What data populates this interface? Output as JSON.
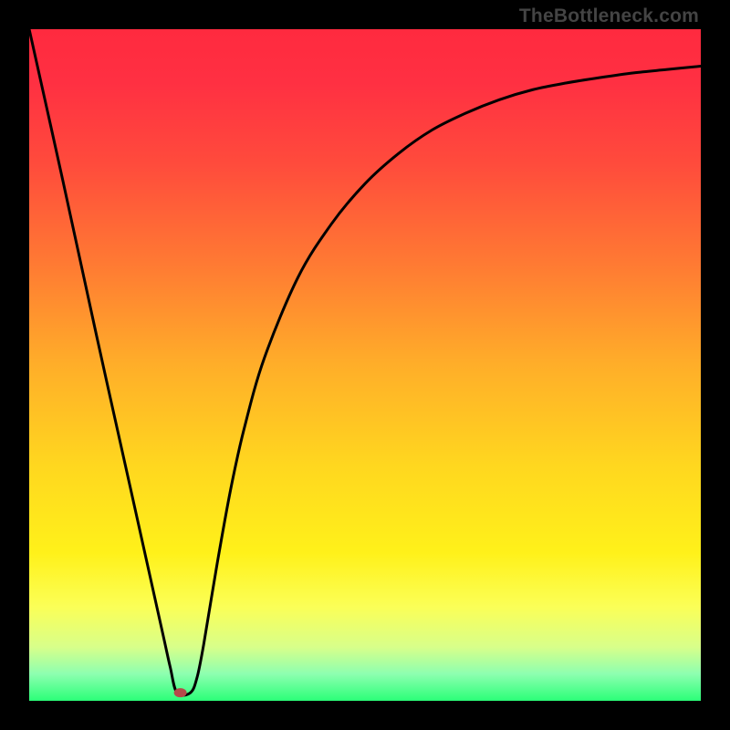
{
  "watermark": "TheBottleneck.com",
  "gradient_stops": [
    {
      "offset": 0.0,
      "color": "#ff2a3f"
    },
    {
      "offset": 0.08,
      "color": "#ff3042"
    },
    {
      "offset": 0.2,
      "color": "#ff4b3c"
    },
    {
      "offset": 0.35,
      "color": "#ff7a33"
    },
    {
      "offset": 0.5,
      "color": "#ffae29"
    },
    {
      "offset": 0.65,
      "color": "#ffd71f"
    },
    {
      "offset": 0.78,
      "color": "#fff11a"
    },
    {
      "offset": 0.86,
      "color": "#fbff57"
    },
    {
      "offset": 0.92,
      "color": "#d8ff8a"
    },
    {
      "offset": 0.96,
      "color": "#8dffb0"
    },
    {
      "offset": 1.0,
      "color": "#2bff78"
    }
  ],
  "marker": {
    "x": 0.225,
    "y_from_bottom": 0.012,
    "rx": 7,
    "ry": 5,
    "color": "#b54a4a"
  },
  "chart_data": {
    "type": "line",
    "title": "",
    "xlabel": "",
    "ylabel": "",
    "xlim": [
      0,
      1
    ],
    "ylim": [
      0,
      1
    ],
    "note": "Axes are unlabeled in the source image; values are normalized fractions of the plot area. y is measured from the bottom (0 = bottom edge, 1 = top edge).",
    "series": [
      {
        "name": "bottleneck-curve",
        "x": [
          0.0,
          0.05,
          0.1,
          0.15,
          0.18,
          0.2,
          0.21,
          0.22,
          0.24,
          0.25,
          0.26,
          0.28,
          0.3,
          0.32,
          0.35,
          0.4,
          0.45,
          0.5,
          0.55,
          0.6,
          0.65,
          0.7,
          0.75,
          0.8,
          0.85,
          0.9,
          0.95,
          1.0
        ],
        "y": [
          1.0,
          0.775,
          0.545,
          0.32,
          0.185,
          0.095,
          0.05,
          0.012,
          0.012,
          0.035,
          0.085,
          0.205,
          0.315,
          0.405,
          0.51,
          0.63,
          0.71,
          0.77,
          0.815,
          0.85,
          0.875,
          0.895,
          0.91,
          0.92,
          0.928,
          0.935,
          0.94,
          0.945
        ]
      }
    ],
    "marker_point": {
      "x": 0.225,
      "y": 0.012
    }
  }
}
